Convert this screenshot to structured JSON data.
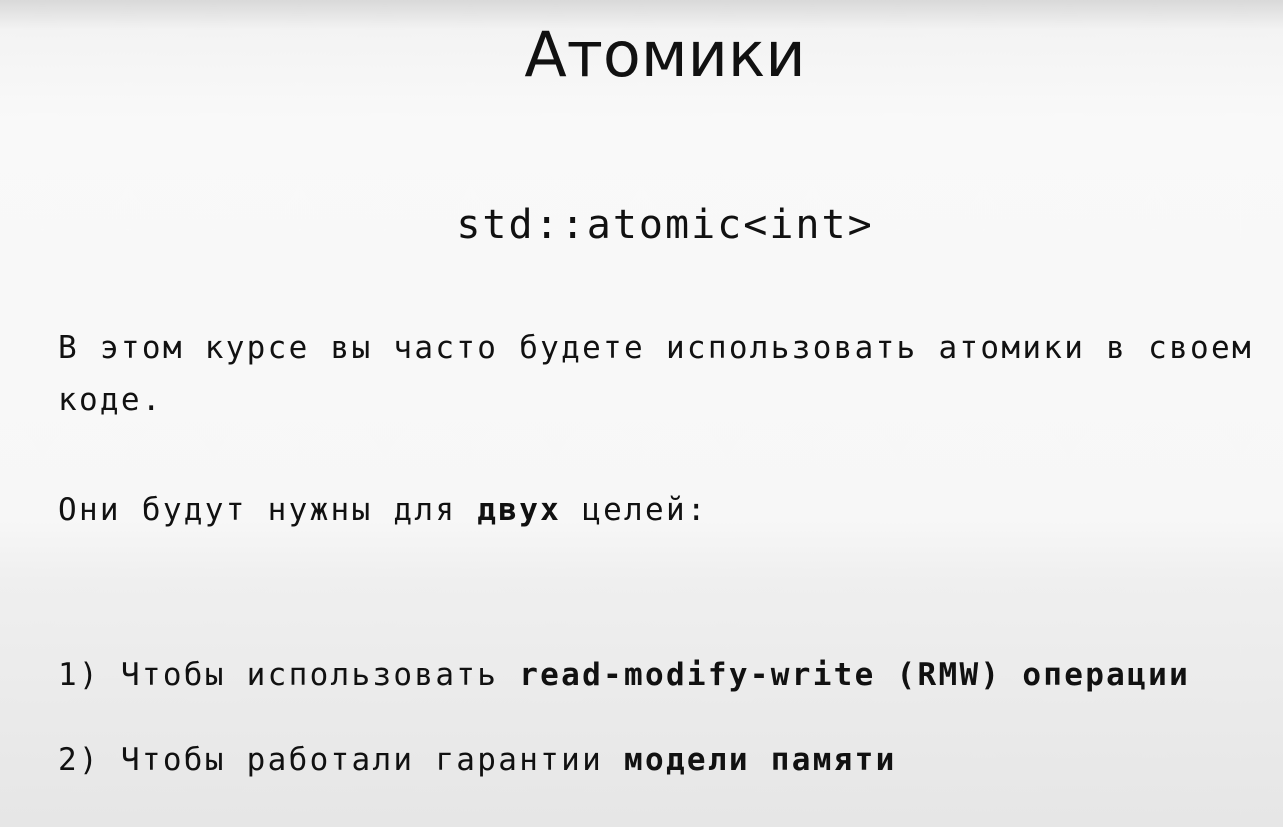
{
  "title": "Атомики",
  "code": "std::atomic<int>",
  "paragraph_line1": "В этом курсе вы часто будете использовать атомики в своем",
  "paragraph_line2": "коде.",
  "purpose": {
    "prefix": "Они будут нужны для ",
    "bold": "двух",
    "suffix": " целей:"
  },
  "items": [
    {
      "prefix": "1) Чтобы использовать ",
      "bold": "read-modify-write (RMW) операции"
    },
    {
      "prefix": "2) Чтобы работали гарантии ",
      "bold": "модели памяти"
    }
  ]
}
